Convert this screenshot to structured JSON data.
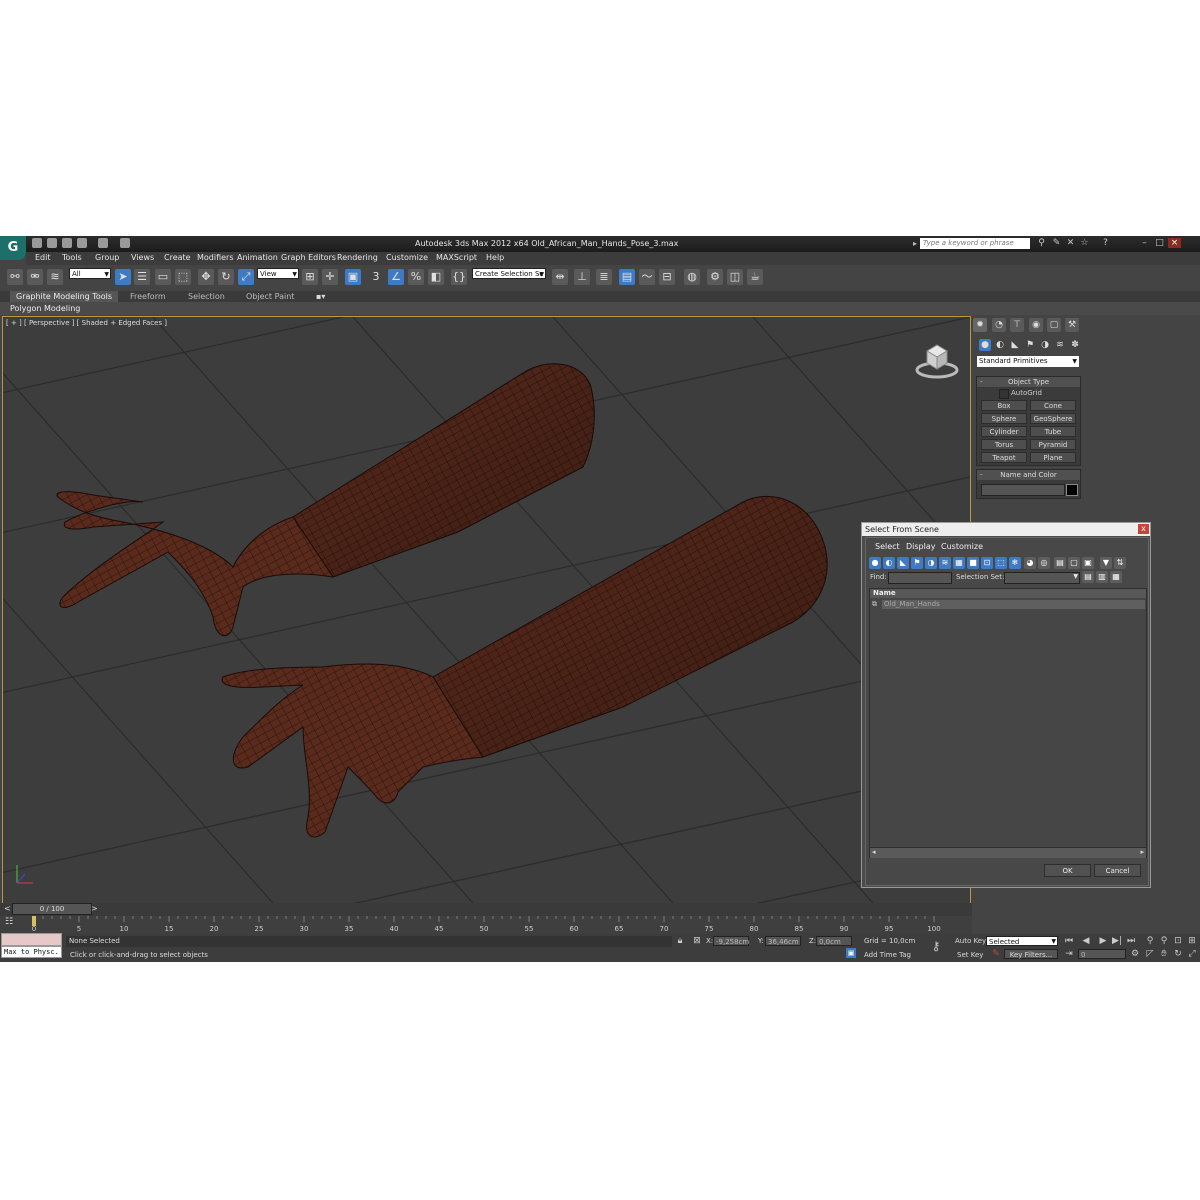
{
  "app": {
    "logo_letter": "G",
    "title": "Autodesk 3ds Max  2012 x64      Old_African_Man_Hands_Pose_3.max",
    "search_placeholder": "Type a keyword or phrase"
  },
  "menu": [
    "Edit",
    "Tools",
    "Group",
    "Views",
    "Create",
    "Modifiers",
    "Animation",
    "Graph Editors",
    "Rendering",
    "Customize",
    "MAXScript",
    "Help"
  ],
  "toolbar": {
    "selection_filter": "All",
    "reference_coord": "View",
    "create_selection_set": "Create Selection Se",
    "snap_number": "3"
  },
  "ribbon": {
    "tabs": [
      "Graphite Modeling Tools",
      "Freeform",
      "Selection",
      "Object Paint"
    ],
    "active_tab": "Graphite Modeling Tools",
    "panel_label": "Polygon Modeling"
  },
  "viewport": {
    "label": "[ + ] [ Perspective ] [ Shaded + Edged Faces ]"
  },
  "command_panel": {
    "category": "Standard Primitives",
    "object_type_title": "Object Type",
    "autogrid": "AutoGrid",
    "buttons": [
      "Box",
      "Cone",
      "Sphere",
      "GeoSphere",
      "Cylinder",
      "Tube",
      "Torus",
      "Pyramid",
      "Teapot",
      "Plane"
    ],
    "name_color_title": "Name and Color"
  },
  "dialog": {
    "title": "Select From Scene",
    "close": "x",
    "menu": [
      "Select",
      "Display",
      "Customize"
    ],
    "find_label": "Find:",
    "selection_set_label": "Selection Set:",
    "list_header": "Name",
    "items": [
      "Old_Man_Hands"
    ],
    "ok": "OK",
    "cancel": "Cancel"
  },
  "timeline": {
    "frame_display": "0 / 100",
    "ticks": [
      "0",
      "5",
      "10",
      "15",
      "20",
      "25",
      "30",
      "35",
      "40",
      "45",
      "50",
      "55",
      "60",
      "65",
      "70",
      "75",
      "80",
      "85",
      "90",
      "95",
      "100"
    ]
  },
  "status": {
    "maxscript_listener": "Max to Physc.",
    "selection": "None Selected",
    "prompt": "Click or click-and-drag to select objects",
    "x_label": "X:",
    "x_value": "-9,258cm",
    "y_label": "Y:",
    "y_value": "36,46cm",
    "z_label": "Z:",
    "z_value": "0,0cm",
    "grid": "Grid = 10,0cm",
    "add_time_tag": "Add Time Tag",
    "auto_key": "Auto Key",
    "set_key": "Set Key",
    "key_mode": "Selected",
    "key_filters": "Key Filters...",
    "current_frame": "0"
  },
  "colors": {
    "viewport_bg": "#3d3d3d",
    "skin": "#5a2a1c",
    "active_blue": "#3f7bc4",
    "listener_pink": "#e6c8c8"
  }
}
